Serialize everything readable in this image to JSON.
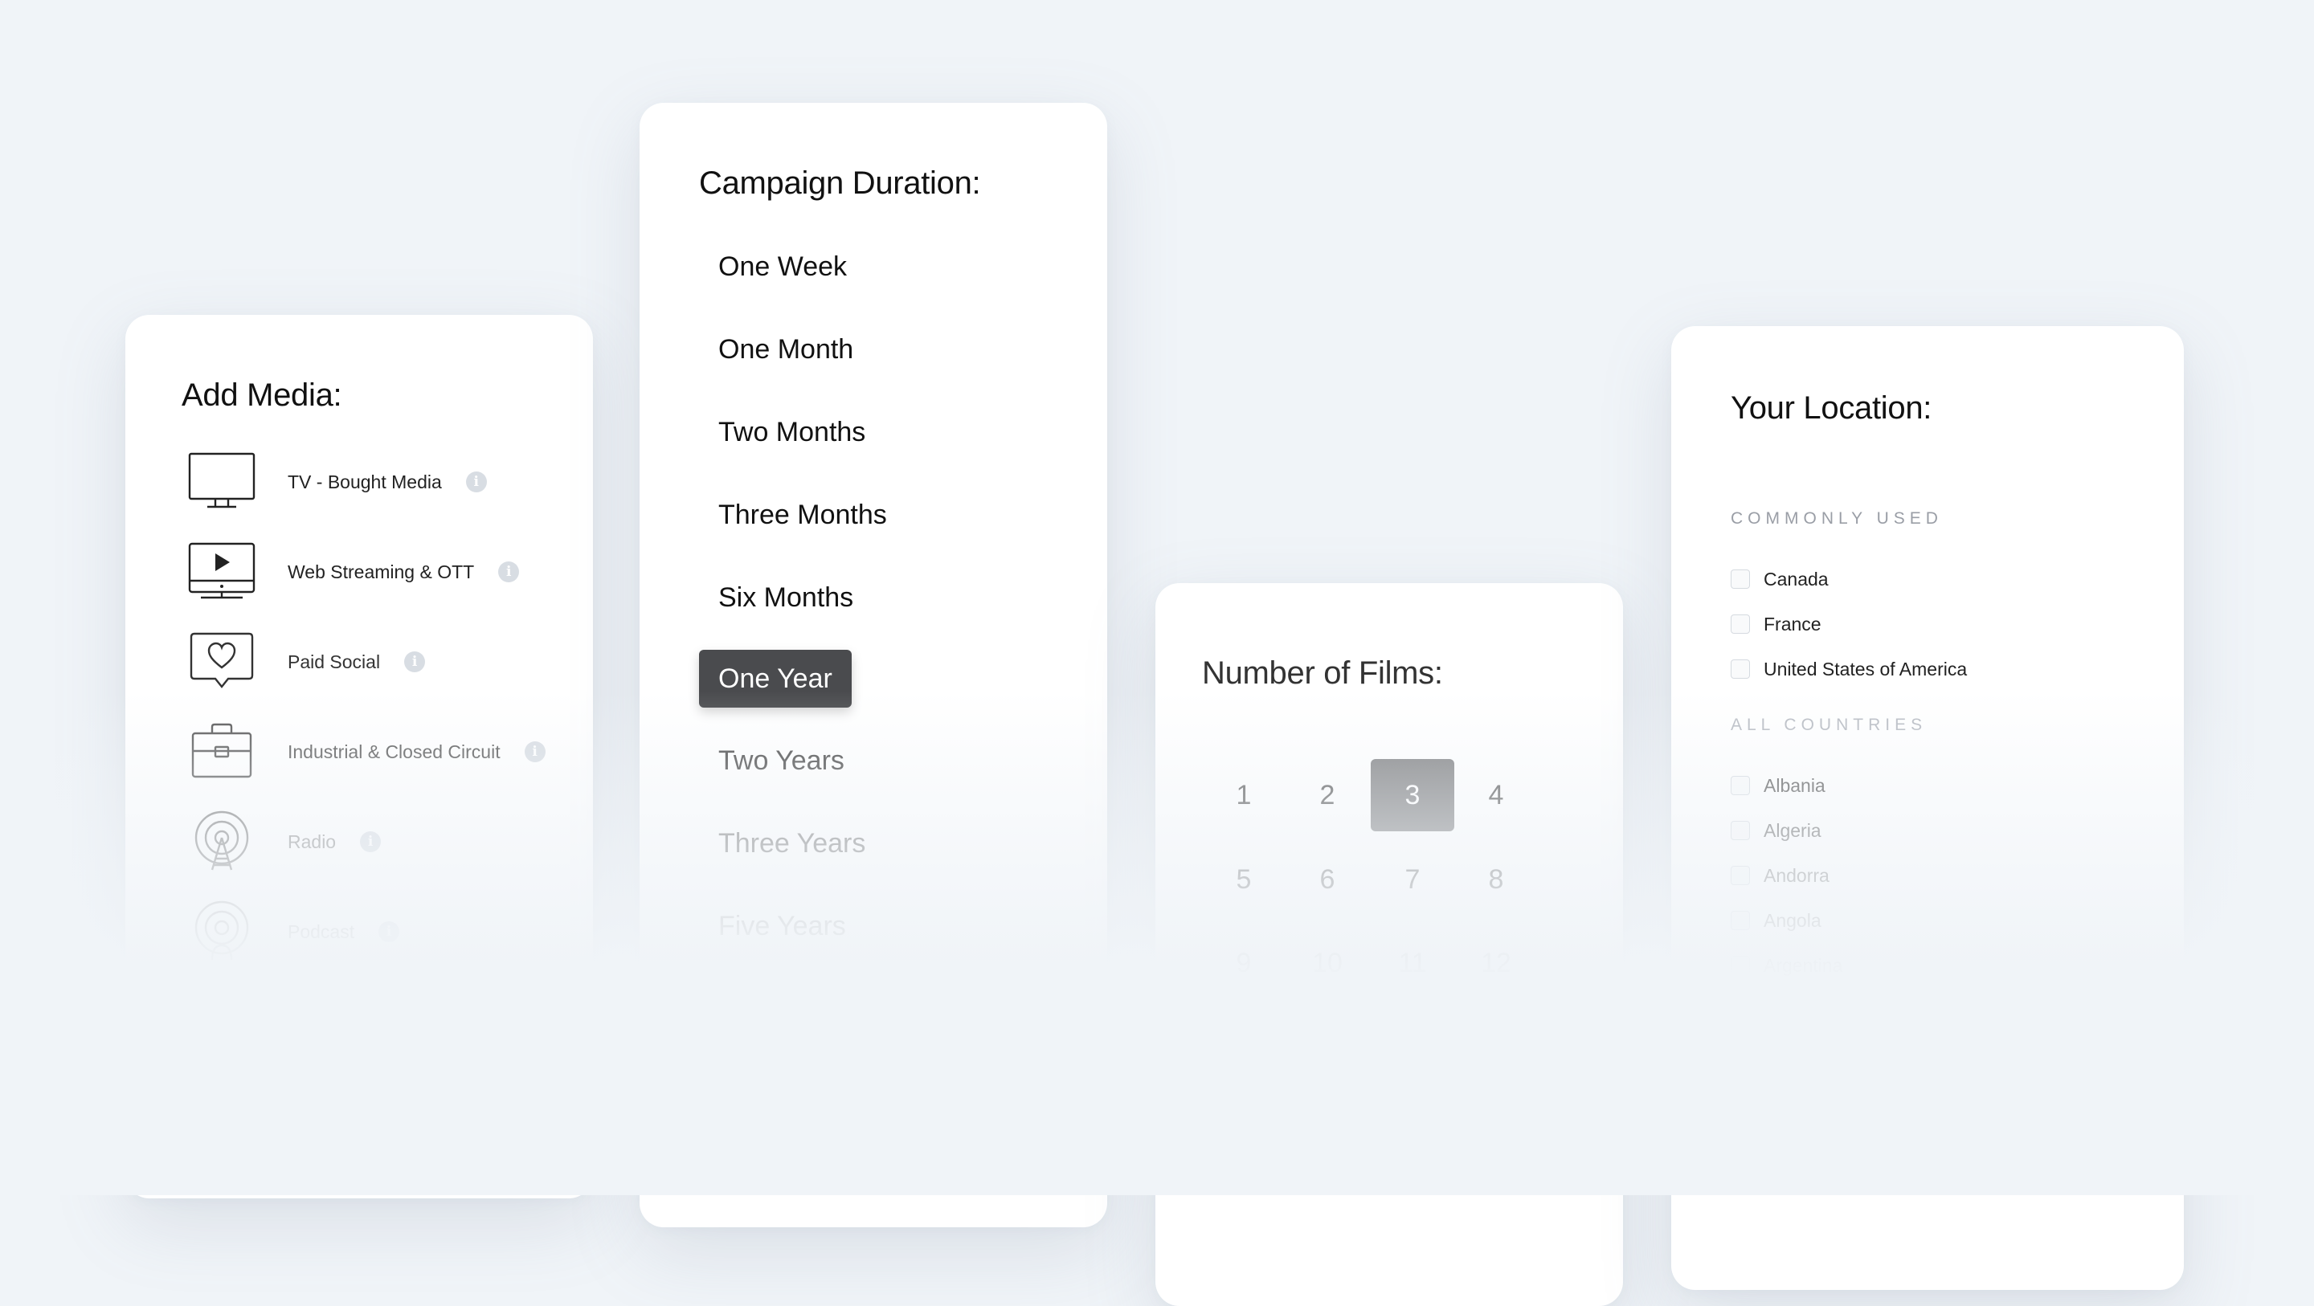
{
  "media": {
    "title": "Add Media:",
    "items": [
      {
        "label": "TV - Bought Media",
        "icon": "tv-icon",
        "info": "i"
      },
      {
        "label": "Web Streaming & OTT",
        "icon": "streaming-icon",
        "info": "i"
      },
      {
        "label": "Paid Social",
        "icon": "social-heart-icon",
        "info": "i"
      },
      {
        "label": "Industrial & Closed Circuit",
        "icon": "briefcase-icon",
        "info": "i"
      },
      {
        "label": "Radio",
        "icon": "radio-tower-icon",
        "info": "i"
      },
      {
        "label": "Podcast",
        "icon": "podcast-icon",
        "info": "i"
      }
    ]
  },
  "duration": {
    "title": "Campaign Duration:",
    "options": [
      "One Week",
      "One Month",
      "Two Months",
      "Three Months",
      "Six Months",
      "One Year",
      "Two Years",
      "Three Years",
      "Five Years"
    ],
    "selected": "One Year"
  },
  "films": {
    "title": "Number of Films:",
    "numbers": [
      "1",
      "2",
      "3",
      "4",
      "5",
      "6",
      "7",
      "8",
      "9",
      "10",
      "11",
      "12"
    ],
    "selected": "3"
  },
  "location": {
    "title": "Your Location:",
    "common_heading": "COMMONLY USED",
    "common": [
      "Canada",
      "France",
      "United States of America"
    ],
    "all_heading": "ALL COUNTRIES",
    "all": [
      "Albania",
      "Algeria",
      "Andorra",
      "Angola",
      "Argentina"
    ]
  },
  "colors": {
    "background": "#f0f4f8",
    "card": "#ffffff",
    "selected_dark": "#4a4b4e",
    "selected_gray": "#7d7e80",
    "info_icon": "#d8dde3"
  }
}
